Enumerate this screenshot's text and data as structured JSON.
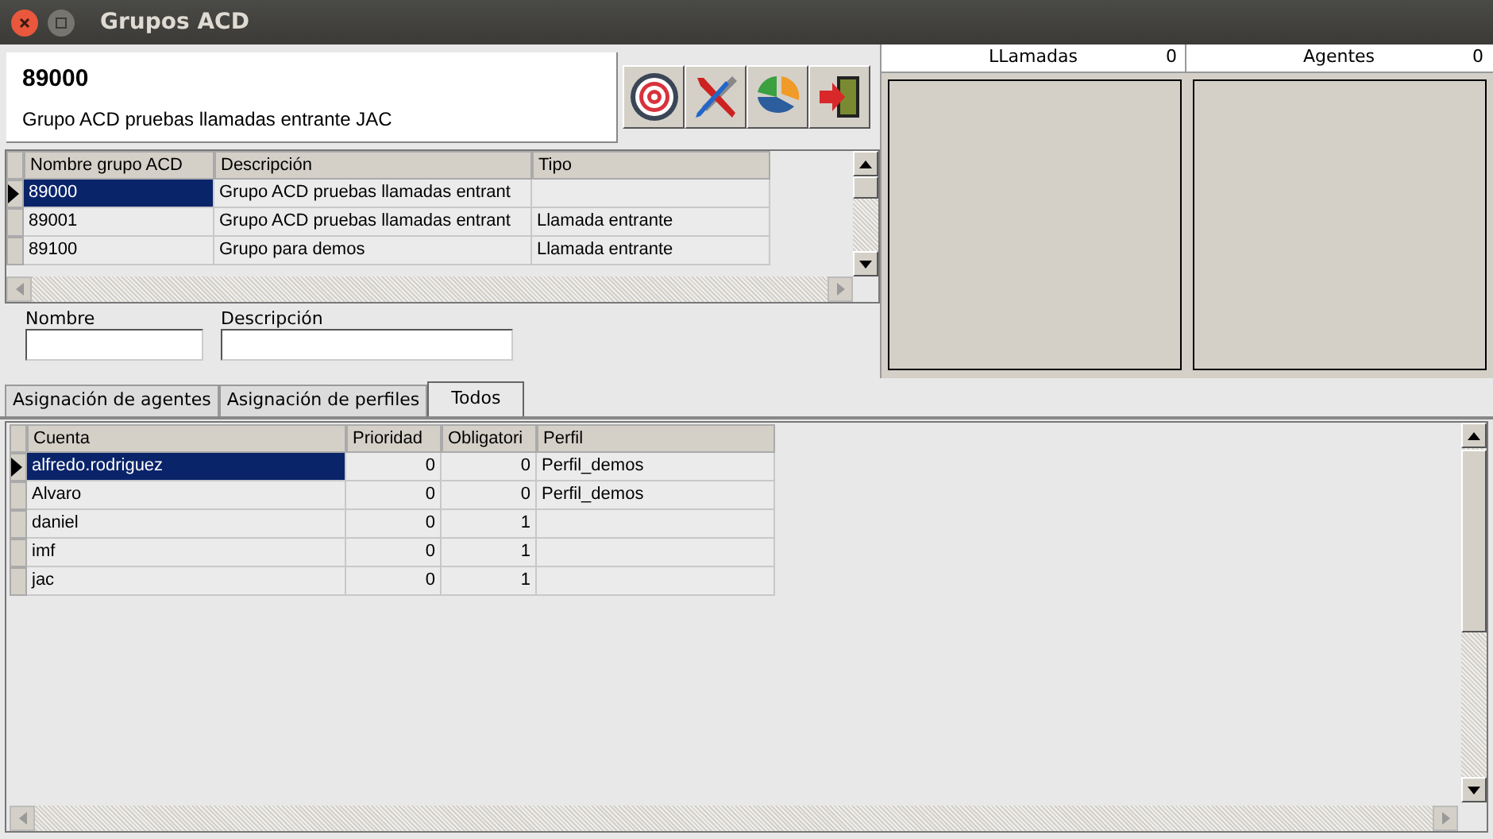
{
  "window": {
    "title": "Grupos ACD"
  },
  "header": {
    "code": "89000",
    "description": "Grupo ACD pruebas llamadas entrante JAC"
  },
  "groups_table": {
    "columns": [
      "Nombre grupo ACD",
      "Descripción",
      "Tipo"
    ],
    "rows": [
      {
        "cells": [
          "89000",
          "Grupo ACD pruebas llamadas entrant",
          ""
        ],
        "selected": true
      },
      {
        "cells": [
          "89001",
          "Grupo ACD pruebas llamadas entrant",
          "Llamada entrante"
        ],
        "selected": false
      },
      {
        "cells": [
          "89100",
          "Grupo para demos",
          "Llamada entrante"
        ],
        "selected": false
      }
    ]
  },
  "filters": [
    {
      "label": "Nombre"
    },
    {
      "label": "Descripción"
    }
  ],
  "counters": [
    {
      "label": "LLamadas",
      "value": "0"
    },
    {
      "label": "Agentes",
      "value": "0"
    }
  ],
  "tabs": [
    {
      "label": "Asignación de agentes",
      "selected": false
    },
    {
      "label": "Asignación de perfiles",
      "selected": false
    },
    {
      "label": "Todos",
      "selected": true
    }
  ],
  "agents_table": {
    "columns": [
      "Cuenta",
      "Prioridad",
      "Obligatori",
      "Perfil"
    ],
    "rows": [
      {
        "cells": [
          "alfredo.rodriguez",
          "0",
          "0",
          "Perfil_demos"
        ],
        "selected": true
      },
      {
        "cells": [
          "Alvaro",
          "0",
          "0",
          "Perfil_demos"
        ],
        "selected": false
      },
      {
        "cells": [
          "daniel",
          "0",
          "1",
          ""
        ],
        "selected": false
      },
      {
        "cells": [
          "imf",
          "0",
          "1",
          ""
        ],
        "selected": false
      },
      {
        "cells": [
          "jac",
          "0",
          "1",
          ""
        ],
        "selected": false
      }
    ]
  }
}
